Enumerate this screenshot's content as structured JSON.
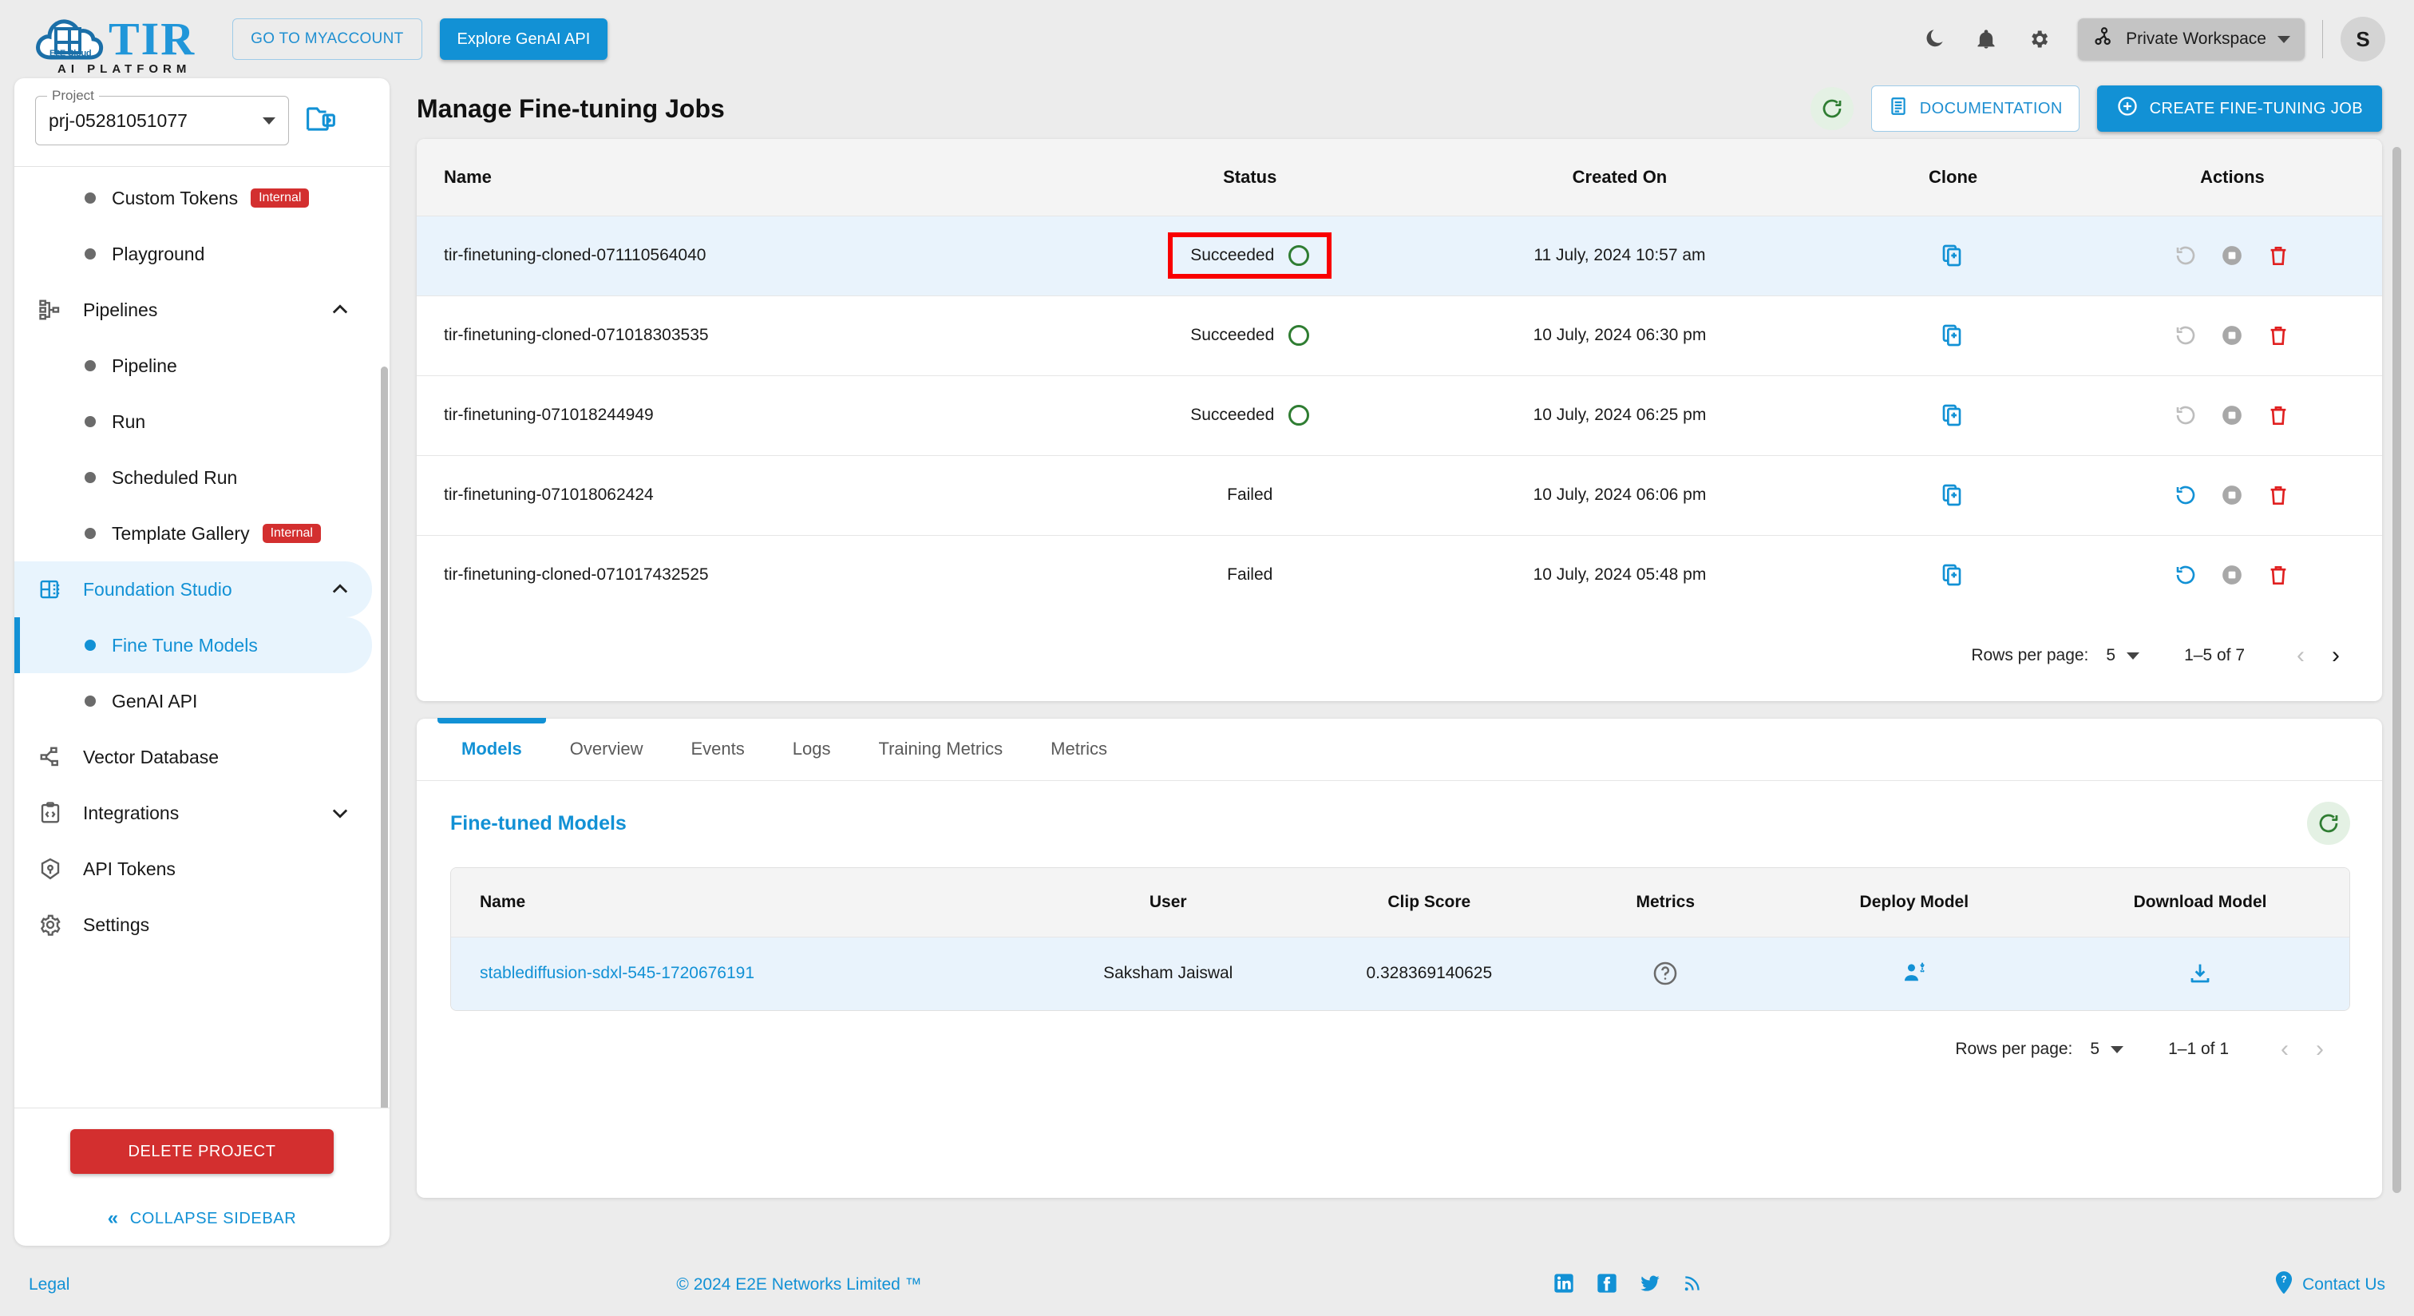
{
  "topbar": {
    "logo_title": "TIR",
    "logo_subtitle": "AI PLATFORM",
    "logo_badge": "E2E Cloud",
    "myaccount_label": "GO TO MYACCOUNT",
    "genai_label": "Explore GenAI API",
    "dark_mode_icon": "moon-icon",
    "notifications_icon": "bell-icon",
    "settings_icon": "gear-icon",
    "workspace_label": "Private Workspace",
    "workspace_icon": "workspace-icon",
    "avatar_initial": "S"
  },
  "sidebar": {
    "project_legend": "Project",
    "project_value": "prj-05281051077",
    "new_folder_icon": "new-folder-icon",
    "items": [
      {
        "label": "Custom Tokens",
        "icon": "dot-icon",
        "badge": "Internal",
        "type": "child",
        "state": "normal"
      },
      {
        "label": "Playground",
        "icon": "dot-icon",
        "badge": "",
        "type": "child",
        "state": "normal"
      },
      {
        "label": "Pipelines",
        "icon": "pipelines-icon",
        "badge": "",
        "type": "group",
        "state": "expanded"
      },
      {
        "label": "Pipeline",
        "icon": "dot-icon",
        "badge": "",
        "type": "child",
        "state": "normal"
      },
      {
        "label": "Run",
        "icon": "dot-icon",
        "badge": "",
        "type": "child",
        "state": "normal"
      },
      {
        "label": "Scheduled Run",
        "icon": "dot-icon",
        "badge": "",
        "type": "child",
        "state": "normal"
      },
      {
        "label": "Template Gallery",
        "icon": "dot-icon",
        "badge": "Internal",
        "type": "child",
        "state": "normal"
      },
      {
        "label": "Foundation Studio",
        "icon": "foundation-studio-icon",
        "badge": "",
        "type": "group",
        "state": "expanded-active"
      },
      {
        "label": "Fine Tune Models",
        "icon": "dot-icon",
        "badge": "",
        "type": "child",
        "state": "current"
      },
      {
        "label": "GenAI API",
        "icon": "dot-icon",
        "badge": "",
        "type": "child",
        "state": "normal"
      },
      {
        "label": "Vector Database",
        "icon": "vector-database-icon",
        "badge": "",
        "type": "group",
        "state": "normal"
      },
      {
        "label": "Integrations",
        "icon": "integrations-icon",
        "badge": "",
        "type": "group",
        "state": "collapsed"
      },
      {
        "label": "API Tokens",
        "icon": "api-tokens-icon",
        "badge": "",
        "type": "group",
        "state": "normal"
      },
      {
        "label": "Settings",
        "icon": "gear-icon",
        "badge": "",
        "type": "group",
        "state": "normal"
      }
    ],
    "delete_project_label": "DELETE PROJECT",
    "collapse_label": "COLLAPSE SIDEBAR"
  },
  "page": {
    "title": "Manage Fine-tuning Jobs",
    "refresh_icon": "refresh-icon",
    "documentation_label": "DOCUMENTATION",
    "documentation_icon": "document-icon",
    "create_label": "CREATE FINE-TUNING JOB",
    "create_icon": "plus-circle-icon"
  },
  "jobs_table": {
    "columns": [
      "Name",
      "Status",
      "Created On",
      "Clone",
      "Actions"
    ],
    "rows": [
      {
        "name": "tir-finetuning-cloned-071110564040",
        "status": "Succeeded",
        "created_on": "11 July, 2024 10:57 am",
        "highlighted": true,
        "status_boxed": true,
        "retry_enabled": false
      },
      {
        "name": "tir-finetuning-cloned-071018303535",
        "status": "Succeeded",
        "created_on": "10 July, 2024 06:30 pm",
        "highlighted": false,
        "status_boxed": false,
        "retry_enabled": false
      },
      {
        "name": "tir-finetuning-071018244949",
        "status": "Succeeded",
        "created_on": "10 July, 2024 06:25 pm",
        "highlighted": false,
        "status_boxed": false,
        "retry_enabled": false
      },
      {
        "name": "tir-finetuning-071018062424",
        "status": "Failed",
        "created_on": "10 July, 2024 06:06 pm",
        "highlighted": false,
        "status_boxed": false,
        "retry_enabled": true
      },
      {
        "name": "tir-finetuning-cloned-071017432525",
        "status": "Failed",
        "created_on": "10 July, 2024 05:48 pm",
        "highlighted": false,
        "status_boxed": false,
        "retry_enabled": true
      }
    ],
    "pager": {
      "rows_per_page_label": "Rows per page:",
      "rows_per_page_value": "5",
      "range": "1–5 of 7",
      "prev_enabled": false,
      "next_enabled": true
    }
  },
  "tabs": [
    {
      "label": "Models",
      "active": true
    },
    {
      "label": "Overview",
      "active": false
    },
    {
      "label": "Events",
      "active": false
    },
    {
      "label": "Logs",
      "active": false
    },
    {
      "label": "Training Metrics",
      "active": false
    },
    {
      "label": "Metrics",
      "active": false
    }
  ],
  "models_section": {
    "title": "Fine-tuned Models",
    "refresh_icon": "refresh-icon",
    "columns": [
      "Name",
      "User",
      "Clip Score",
      "Metrics",
      "Deploy Model",
      "Download Model"
    ],
    "rows": [
      {
        "name": "stablediffusion-sdxl-545-1720676191",
        "user": "Saksham Jaiswal",
        "clip_score": "0.328369140625",
        "metrics_icon": "help-circle-icon",
        "deploy_icon": "deploy-model-icon",
        "download_icon": "download-icon"
      }
    ],
    "pager": {
      "rows_per_page_label": "Rows per page:",
      "rows_per_page_value": "5",
      "range": "1–1 of 1",
      "prev_enabled": false,
      "next_enabled": false
    }
  },
  "footer": {
    "legal": "Legal",
    "copyright": "© 2024 E2E Networks Limited ™",
    "social": [
      "linkedin-icon",
      "facebook-icon",
      "twitter-icon",
      "rss-icon"
    ],
    "contact": "Contact Us",
    "contact_icon": "help-badge-icon"
  },
  "colors": {
    "accent": "#1291d5",
    "danger": "#d32f2f",
    "success": "#2f7d32",
    "highlight_box": "#f90000",
    "row_highlight": "#e9f3fc"
  }
}
